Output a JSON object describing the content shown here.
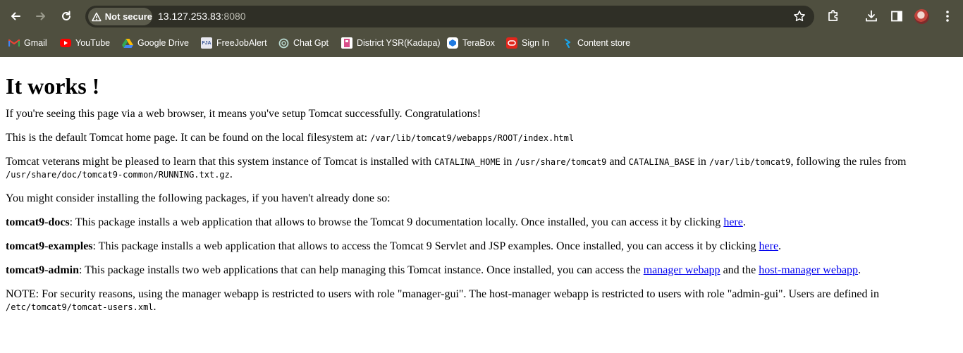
{
  "browser": {
    "security_label": "Not secure",
    "url_host": "13.127.253.83",
    "url_port": ":8080",
    "bookmarks": [
      {
        "label": "Gmail",
        "icon": "gmail-icon",
        "color": "#ea4335"
      },
      {
        "label": "YouTube",
        "icon": "youtube-icon",
        "color": "#ff0000"
      },
      {
        "label": "Google Drive",
        "icon": "google-drive-icon",
        "color": "#34a853"
      },
      {
        "label": "FreeJobAlert",
        "icon": "freejobalert-icon",
        "color": "#3b5998"
      },
      {
        "label": "Chat Gpt",
        "icon": "chatgpt-icon",
        "color": "#74aa9c"
      },
      {
        "label": "District YSR(Kadapa)",
        "icon": "district-icon",
        "color": "#ffffff"
      },
      {
        "label": "TeraBox",
        "icon": "terabox-icon",
        "color": "#1f7ae0"
      },
      {
        "label": "Sign In",
        "icon": "oracle-icon",
        "color": "#e1261c"
      },
      {
        "label": "Content store",
        "icon": "content-store-icon",
        "color": "#1aa3e8"
      }
    ]
  },
  "page": {
    "title": "It works !",
    "intro": "If you're seeing this page via a web browser, it means you've setup Tomcat successfully. Congratulations!",
    "default_home_text": "This is the default Tomcat home page. It can be found on the local filesystem at: ",
    "default_home_path": "/var/lib/tomcat9/webapps/ROOT/index.html",
    "veterans_1": "Tomcat veterans might be pleased to learn that this system instance of Tomcat is installed with ",
    "catalina_home": "CATALINA_HOME",
    "veterans_2": " in ",
    "catalina_home_path": "/usr/share/tomcat9",
    "veterans_3": " and ",
    "catalina_base": "CATALINA_BASE",
    "veterans_4": " in ",
    "catalina_base_path": "/var/lib/tomcat9",
    "veterans_5": ", following the rules from ",
    "running_path": "/usr/share/doc/tomcat9-common/RUNNING.txt.gz",
    "veterans_6": ".",
    "packages_intro": "You might consider installing the following packages, if you haven't already done so:",
    "docs_name": "tomcat9-docs",
    "docs_text": ": This package installs a web application that allows to browse the Tomcat 9 documentation locally. Once installed, you can access it by clicking ",
    "docs_link": "here",
    "examples_name": "tomcat9-examples",
    "examples_text": ": This package installs a web application that allows to access the Tomcat 9 Servlet and JSP examples. Once installed, you can access it by clicking ",
    "examples_link": "here",
    "admin_name": "tomcat9-admin",
    "admin_text": ": This package installs two web applications that can help managing this Tomcat instance. Once installed, you can access the ",
    "admin_link_manager": "manager webapp",
    "admin_text_2": " and the ",
    "admin_link_host": "host-manager webapp",
    "note_text": "NOTE: For security reasons, using the manager webapp is restricted to users with role \"manager-gui\". The host-manager webapp is restricted to users with role \"admin-gui\". Users are defined in ",
    "note_path": "/etc/tomcat9/tomcat-users.xml",
    "period": "."
  }
}
